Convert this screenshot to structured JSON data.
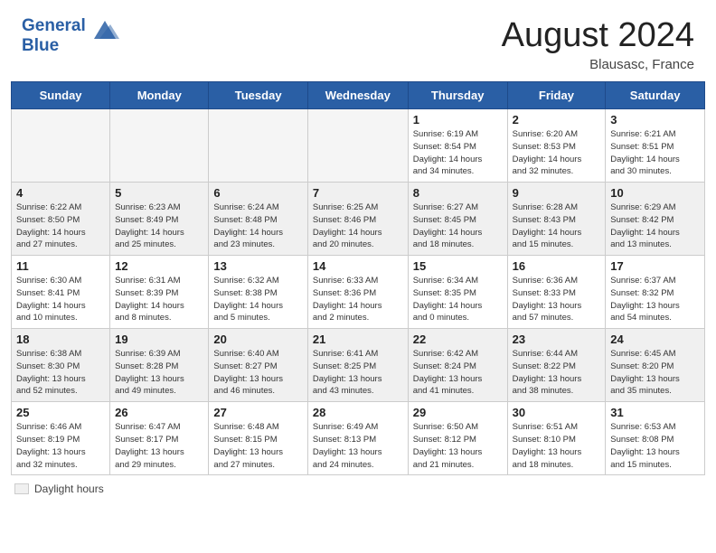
{
  "header": {
    "logo_line1": "General",
    "logo_line2": "Blue",
    "month_year": "August 2024",
    "location": "Blausasc, France"
  },
  "days_of_week": [
    "Sunday",
    "Monday",
    "Tuesday",
    "Wednesday",
    "Thursday",
    "Friday",
    "Saturday"
  ],
  "legend": {
    "box_label": "Daylight hours"
  },
  "weeks": [
    [
      {
        "date": "",
        "empty": true
      },
      {
        "date": "",
        "empty": true
      },
      {
        "date": "",
        "empty": true
      },
      {
        "date": "",
        "empty": true
      },
      {
        "date": "1",
        "info": "Sunrise: 6:19 AM\nSunset: 8:54 PM\nDaylight: 14 hours\nand 34 minutes."
      },
      {
        "date": "2",
        "info": "Sunrise: 6:20 AM\nSunset: 8:53 PM\nDaylight: 14 hours\nand 32 minutes."
      },
      {
        "date": "3",
        "info": "Sunrise: 6:21 AM\nSunset: 8:51 PM\nDaylight: 14 hours\nand 30 minutes."
      }
    ],
    [
      {
        "date": "4",
        "info": "Sunrise: 6:22 AM\nSunset: 8:50 PM\nDaylight: 14 hours\nand 27 minutes."
      },
      {
        "date": "5",
        "info": "Sunrise: 6:23 AM\nSunset: 8:49 PM\nDaylight: 14 hours\nand 25 minutes."
      },
      {
        "date": "6",
        "info": "Sunrise: 6:24 AM\nSunset: 8:48 PM\nDaylight: 14 hours\nand 23 minutes."
      },
      {
        "date": "7",
        "info": "Sunrise: 6:25 AM\nSunset: 8:46 PM\nDaylight: 14 hours\nand 20 minutes."
      },
      {
        "date": "8",
        "info": "Sunrise: 6:27 AM\nSunset: 8:45 PM\nDaylight: 14 hours\nand 18 minutes."
      },
      {
        "date": "9",
        "info": "Sunrise: 6:28 AM\nSunset: 8:43 PM\nDaylight: 14 hours\nand 15 minutes."
      },
      {
        "date": "10",
        "info": "Sunrise: 6:29 AM\nSunset: 8:42 PM\nDaylight: 14 hours\nand 13 minutes."
      }
    ],
    [
      {
        "date": "11",
        "info": "Sunrise: 6:30 AM\nSunset: 8:41 PM\nDaylight: 14 hours\nand 10 minutes."
      },
      {
        "date": "12",
        "info": "Sunrise: 6:31 AM\nSunset: 8:39 PM\nDaylight: 14 hours\nand 8 minutes."
      },
      {
        "date": "13",
        "info": "Sunrise: 6:32 AM\nSunset: 8:38 PM\nDaylight: 14 hours\nand 5 minutes."
      },
      {
        "date": "14",
        "info": "Sunrise: 6:33 AM\nSunset: 8:36 PM\nDaylight: 14 hours\nand 2 minutes."
      },
      {
        "date": "15",
        "info": "Sunrise: 6:34 AM\nSunset: 8:35 PM\nDaylight: 14 hours\nand 0 minutes."
      },
      {
        "date": "16",
        "info": "Sunrise: 6:36 AM\nSunset: 8:33 PM\nDaylight: 13 hours\nand 57 minutes."
      },
      {
        "date": "17",
        "info": "Sunrise: 6:37 AM\nSunset: 8:32 PM\nDaylight: 13 hours\nand 54 minutes."
      }
    ],
    [
      {
        "date": "18",
        "info": "Sunrise: 6:38 AM\nSunset: 8:30 PM\nDaylight: 13 hours\nand 52 minutes."
      },
      {
        "date": "19",
        "info": "Sunrise: 6:39 AM\nSunset: 8:28 PM\nDaylight: 13 hours\nand 49 minutes."
      },
      {
        "date": "20",
        "info": "Sunrise: 6:40 AM\nSunset: 8:27 PM\nDaylight: 13 hours\nand 46 minutes."
      },
      {
        "date": "21",
        "info": "Sunrise: 6:41 AM\nSunset: 8:25 PM\nDaylight: 13 hours\nand 43 minutes."
      },
      {
        "date": "22",
        "info": "Sunrise: 6:42 AM\nSunset: 8:24 PM\nDaylight: 13 hours\nand 41 minutes."
      },
      {
        "date": "23",
        "info": "Sunrise: 6:44 AM\nSunset: 8:22 PM\nDaylight: 13 hours\nand 38 minutes."
      },
      {
        "date": "24",
        "info": "Sunrise: 6:45 AM\nSunset: 8:20 PM\nDaylight: 13 hours\nand 35 minutes."
      }
    ],
    [
      {
        "date": "25",
        "info": "Sunrise: 6:46 AM\nSunset: 8:19 PM\nDaylight: 13 hours\nand 32 minutes."
      },
      {
        "date": "26",
        "info": "Sunrise: 6:47 AM\nSunset: 8:17 PM\nDaylight: 13 hours\nand 29 minutes."
      },
      {
        "date": "27",
        "info": "Sunrise: 6:48 AM\nSunset: 8:15 PM\nDaylight: 13 hours\nand 27 minutes."
      },
      {
        "date": "28",
        "info": "Sunrise: 6:49 AM\nSunset: 8:13 PM\nDaylight: 13 hours\nand 24 minutes."
      },
      {
        "date": "29",
        "info": "Sunrise: 6:50 AM\nSunset: 8:12 PM\nDaylight: 13 hours\nand 21 minutes."
      },
      {
        "date": "30",
        "info": "Sunrise: 6:51 AM\nSunset: 8:10 PM\nDaylight: 13 hours\nand 18 minutes."
      },
      {
        "date": "31",
        "info": "Sunrise: 6:53 AM\nSunset: 8:08 PM\nDaylight: 13 hours\nand 15 minutes."
      }
    ]
  ]
}
